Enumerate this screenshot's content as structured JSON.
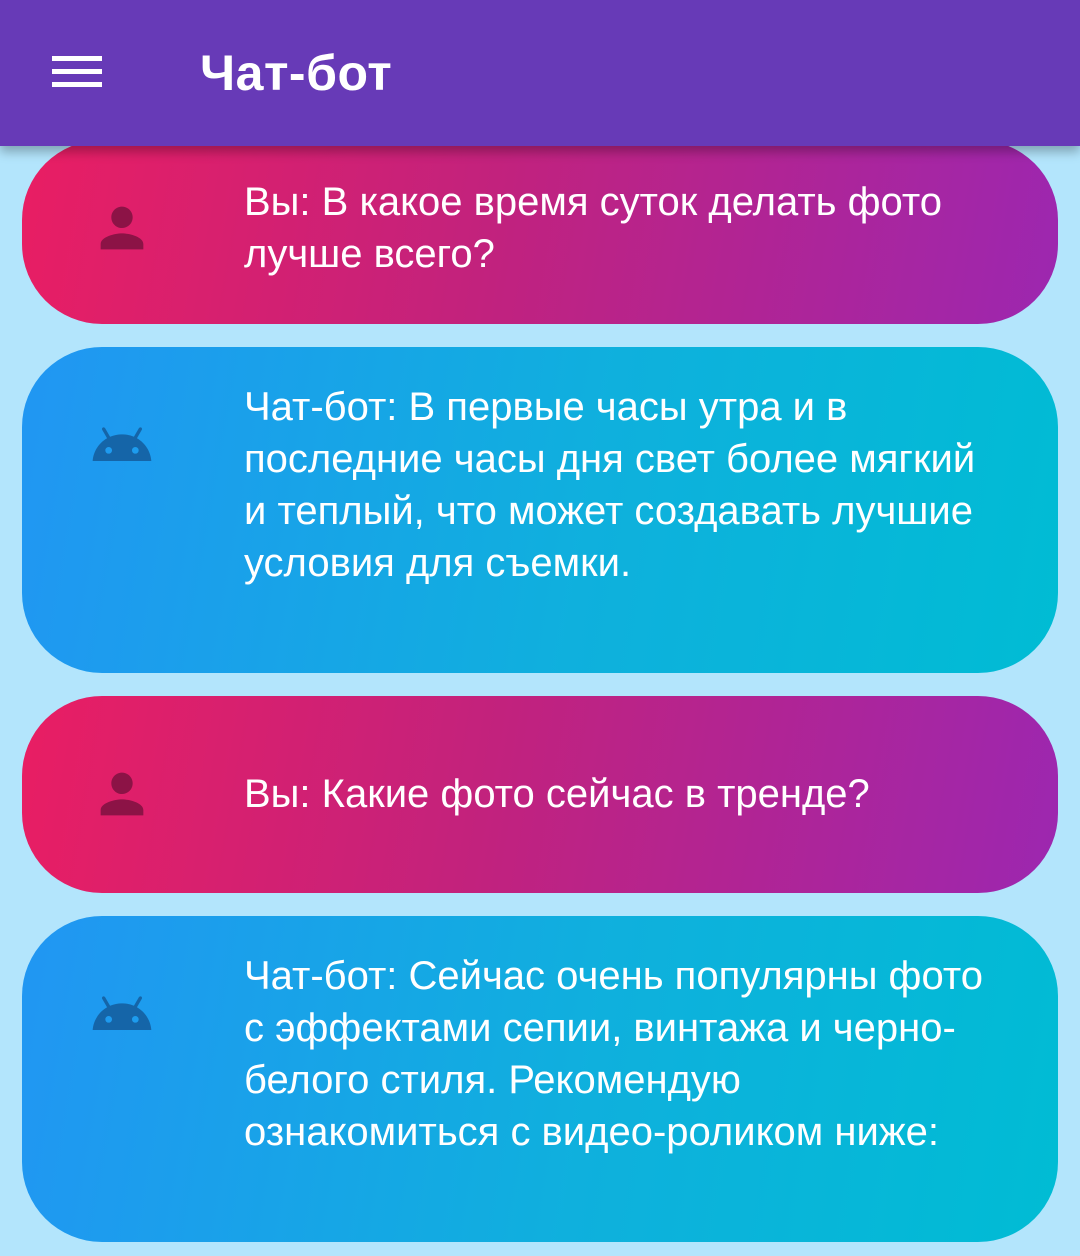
{
  "appbar": {
    "title": "Чат-бот",
    "menu_icon": "hamburger-menu-icon",
    "background_color": "#673ab7"
  },
  "messages": [
    {
      "sender": "user",
      "icon": "person-icon",
      "text": "Вы: В какое время суток делать фото лучше всего?"
    },
    {
      "sender": "bot",
      "icon": "android-icon",
      "text": "Чат-бот: В первые часы утра и в последние часы дня свет более мягкий и теплый, что может создавать лучшие условия для съемки."
    },
    {
      "sender": "user",
      "icon": "person-icon",
      "text": "Вы: Какие фото сейчас в тренде?"
    },
    {
      "sender": "bot",
      "icon": "android-icon",
      "text": "Чат-бот: Сейчас очень популярны фото с эффектами сепии, винтажа и черно-белого стиля. Рекомендую ознакомиться с видео-роликом ниже:"
    }
  ],
  "colors": {
    "user_gradient_start": "#e91e63",
    "user_gradient_end": "#9c27b0",
    "bot_gradient_start": "#2196f3",
    "bot_gradient_end": "#00bcd4",
    "user_icon": "#8c1346",
    "bot_icon": "#1565a8",
    "page_background": "#b3e5fc"
  }
}
